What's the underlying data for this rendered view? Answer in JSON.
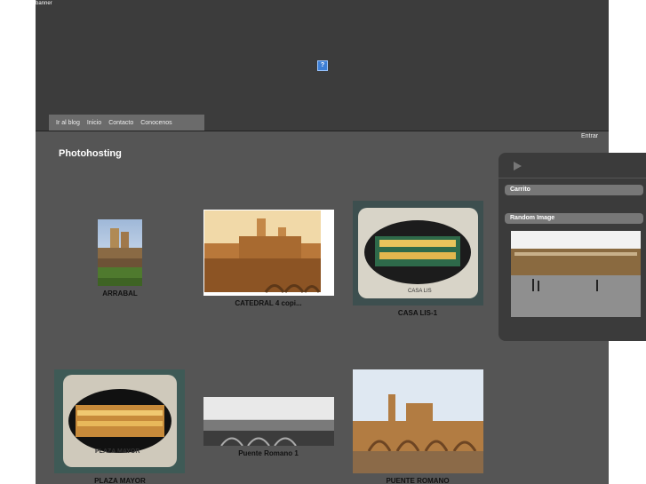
{
  "banner": {
    "label": "banner",
    "plugin_icon": "?"
  },
  "nav": {
    "items": [
      "Ir al blog",
      "Inicio",
      "Contacto",
      "Conocenos"
    ]
  },
  "login": "Entrar",
  "page_title": "Photohosting",
  "gallery": [
    {
      "caption": "ARRABAL"
    },
    {
      "caption": "CATEDRAL 4 copi..."
    },
    {
      "caption": "CASA LIS-1"
    },
    {
      "caption": "PLAZA MAYOR"
    },
    {
      "caption": "Puente Romano 1"
    },
    {
      "caption": "PUENTE ROMANO"
    }
  ],
  "photo_texts": {
    "casa_lis": "CASA LIS",
    "plaza_mayor": "PLAZA MAYOR"
  },
  "sidebar": {
    "cart_label": "Carrito",
    "random_label": "Random Image"
  },
  "colors": {
    "page_bg": "#555555",
    "banner_bg": "#3c3c3c",
    "nav_bg": "#6b6b6b",
    "panel_bg": "#3b3b3b"
  }
}
